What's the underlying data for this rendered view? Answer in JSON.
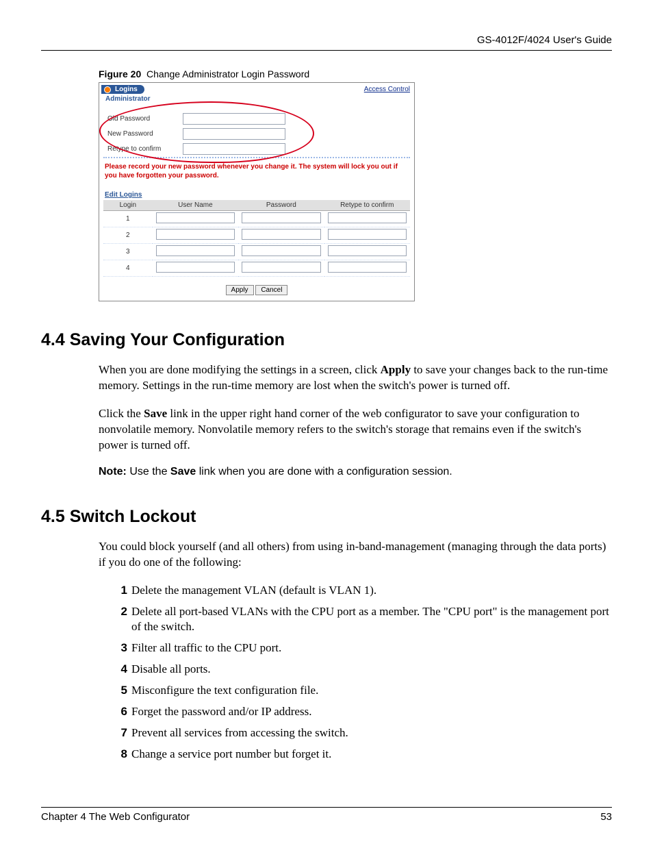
{
  "header": {
    "title": "GS-4012F/4024 User's Guide"
  },
  "figure": {
    "label": "Figure 20",
    "caption": "Change Administrator Login Password"
  },
  "screenshot": {
    "tab": "Logins",
    "administrator": "Administrator",
    "access_control": "Access Control",
    "rows": {
      "old": "Old Password",
      "new": "New Password",
      "retype": "Retype to confirm"
    },
    "warning": "Please record your new password whenever you change it. The system will lock you out if you have forgotten your password.",
    "edit_logins": "Edit Logins",
    "columns": {
      "login": "Login",
      "user": "User Name",
      "password": "Password",
      "retype": "Retype to confirm"
    },
    "login_rows": [
      "1",
      "2",
      "3",
      "4"
    ],
    "buttons": {
      "apply": "Apply",
      "cancel": "Cancel"
    }
  },
  "sections": {
    "s44": {
      "heading": "4.4  Saving Your Configuration",
      "p1a": "When you are done modifying the settings in a screen, click ",
      "p1b": "Apply",
      "p1c": " to save your changes back to the run-time memory. Settings in the run-time memory are lost when the switch's power is turned off.",
      "p2a": "Click the ",
      "p2b": "Save",
      "p2c": " link in the upper right hand corner of the web configurator to save your configuration to nonvolatile memory. Nonvolatile memory refers to the switch's storage that remains even if the switch's power is turned off.",
      "note_a": "Note:",
      "note_b": " Use the ",
      "note_c": "Save",
      "note_d": " link when you are done with a configuration session."
    },
    "s45": {
      "heading": "4.5  Switch Lockout",
      "intro": "You could block yourself (and all others) from using in-band-management (managing through the data ports) if you do one of the following:",
      "items": [
        "Delete the management VLAN (default is VLAN 1).",
        "Delete all port-based VLANs with the CPU port as a member. The \"CPU port\" is the management port of the switch.",
        "Filter all traffic to the CPU port.",
        "Disable all ports.",
        "Misconfigure the text configuration file.",
        "Forget the password and/or IP address.",
        "Prevent all services from accessing the switch.",
        "Change a service port number but forget it."
      ]
    }
  },
  "footer": {
    "chapter": "Chapter 4 The Web Configurator",
    "page": "53"
  }
}
